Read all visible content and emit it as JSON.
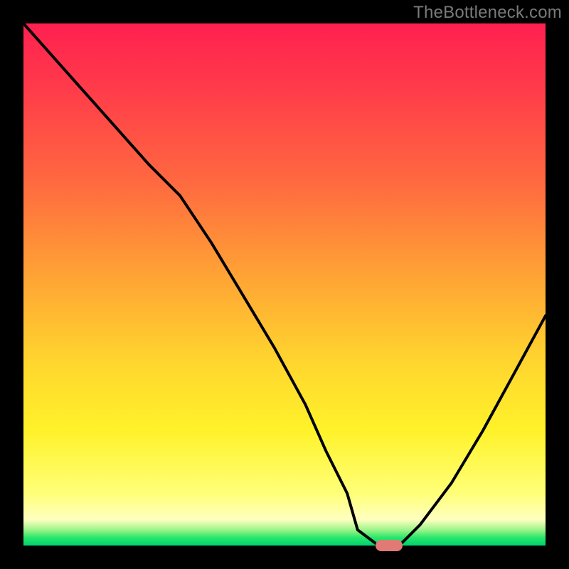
{
  "watermark": "TheBottleneck.com",
  "chart_data": {
    "type": "line",
    "title": "",
    "xlabel": "",
    "ylabel": "",
    "xlim": [
      0,
      100
    ],
    "ylim": [
      0,
      100
    ],
    "grid": false,
    "legend": false,
    "series": [
      {
        "name": "bottleneck-curve",
        "x": [
          0,
          8,
          16,
          24,
          30,
          36,
          42,
          48,
          54,
          58,
          62,
          64,
          68,
          72,
          76,
          82,
          88,
          94,
          100
        ],
        "y": [
          100,
          91,
          82,
          73,
          67,
          58,
          48,
          38,
          27,
          18,
          10,
          3,
          0,
          0,
          4,
          12,
          22,
          33,
          44
        ]
      }
    ],
    "marker": {
      "x": 70,
      "y": 0
    },
    "background_gradient": {
      "stops": [
        {
          "pct": 0,
          "color": "#ff2050"
        },
        {
          "pct": 30,
          "color": "#ff6840"
        },
        {
          "pct": 65,
          "color": "#ffd62e"
        },
        {
          "pct": 90,
          "color": "#ffff78"
        },
        {
          "pct": 97,
          "color": "#9cf58a"
        },
        {
          "pct": 100,
          "color": "#00d36e"
        }
      ]
    }
  }
}
